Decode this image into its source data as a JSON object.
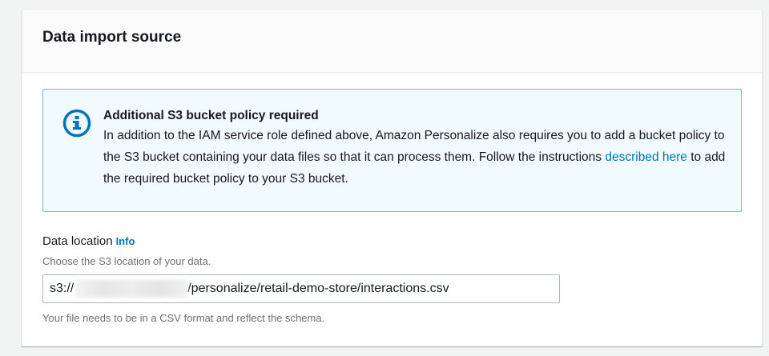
{
  "card": {
    "title": "Data import source"
  },
  "alert": {
    "icon": "info-circle-icon",
    "title": "Additional S3 bucket policy required",
    "line1": "In addition to the IAM service role defined above, Amazon Personalize also requires you to add a bucket policy to the S3 bucket containing your data files so that it can process them. Follow the instructions ",
    "link": "described here",
    "line2": " to add the required bucket policy to your S3 bucket."
  },
  "data_location": {
    "label": "Data location",
    "info": "Info",
    "description": "Choose the S3 location of your data.",
    "value_prefix": "s3://",
    "value_suffix": "/personalize/retail-demo-store/interactions.csv",
    "hint": "Your file needs to be in a CSV format and reflect the schema."
  },
  "colors": {
    "accent": "#0073bb",
    "alert_bg": "#f1faff",
    "alert_border": "#7fb5dd"
  }
}
